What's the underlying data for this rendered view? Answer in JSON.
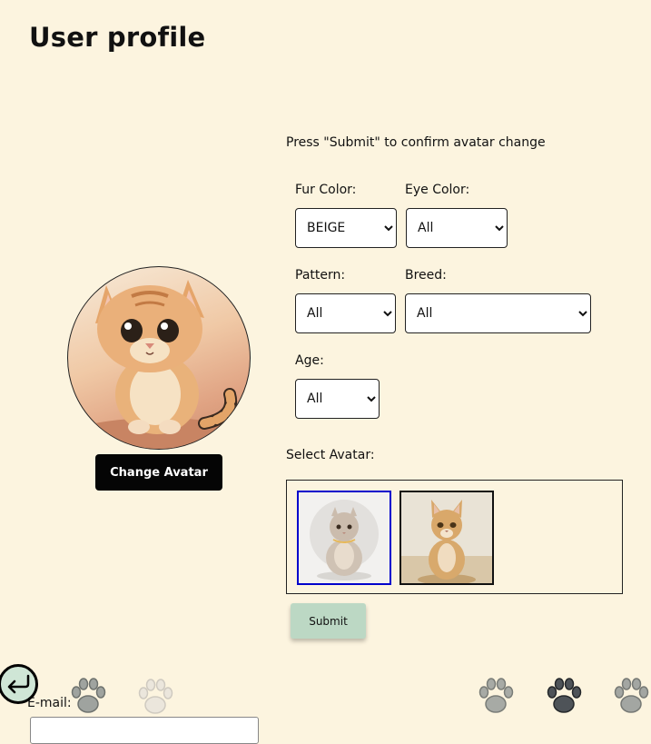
{
  "page": {
    "title": "User profile"
  },
  "instruction": "Press \"Submit\" to confirm avatar change",
  "filters": {
    "fur_color": {
      "label": "Fur Color:",
      "value": "BEIGE"
    },
    "eye_color": {
      "label": "Eye Color:",
      "value": "All"
    },
    "pattern": {
      "label": "Pattern:",
      "value": "All"
    },
    "breed": {
      "label": "Breed:",
      "value": "All"
    },
    "age": {
      "label": "Age:",
      "value": "All"
    }
  },
  "avatar": {
    "change_label": "Change Avatar"
  },
  "avatar_picker": {
    "label": "Select Avatar:",
    "options": [
      {
        "name": "grey-cat-avatar",
        "selected": true
      },
      {
        "name": "tan-cat-avatar",
        "selected": false
      }
    ]
  },
  "submit_label": "Submit",
  "email": {
    "label": "E-mail:"
  },
  "colors": {
    "background": "#fcf4df",
    "submit_button": "#bcd8c4",
    "selected_border": "#0000cc",
    "change_avatar_button": "#050505"
  },
  "icons": [
    "back-arrow-icon",
    "paw-print-icon"
  ]
}
